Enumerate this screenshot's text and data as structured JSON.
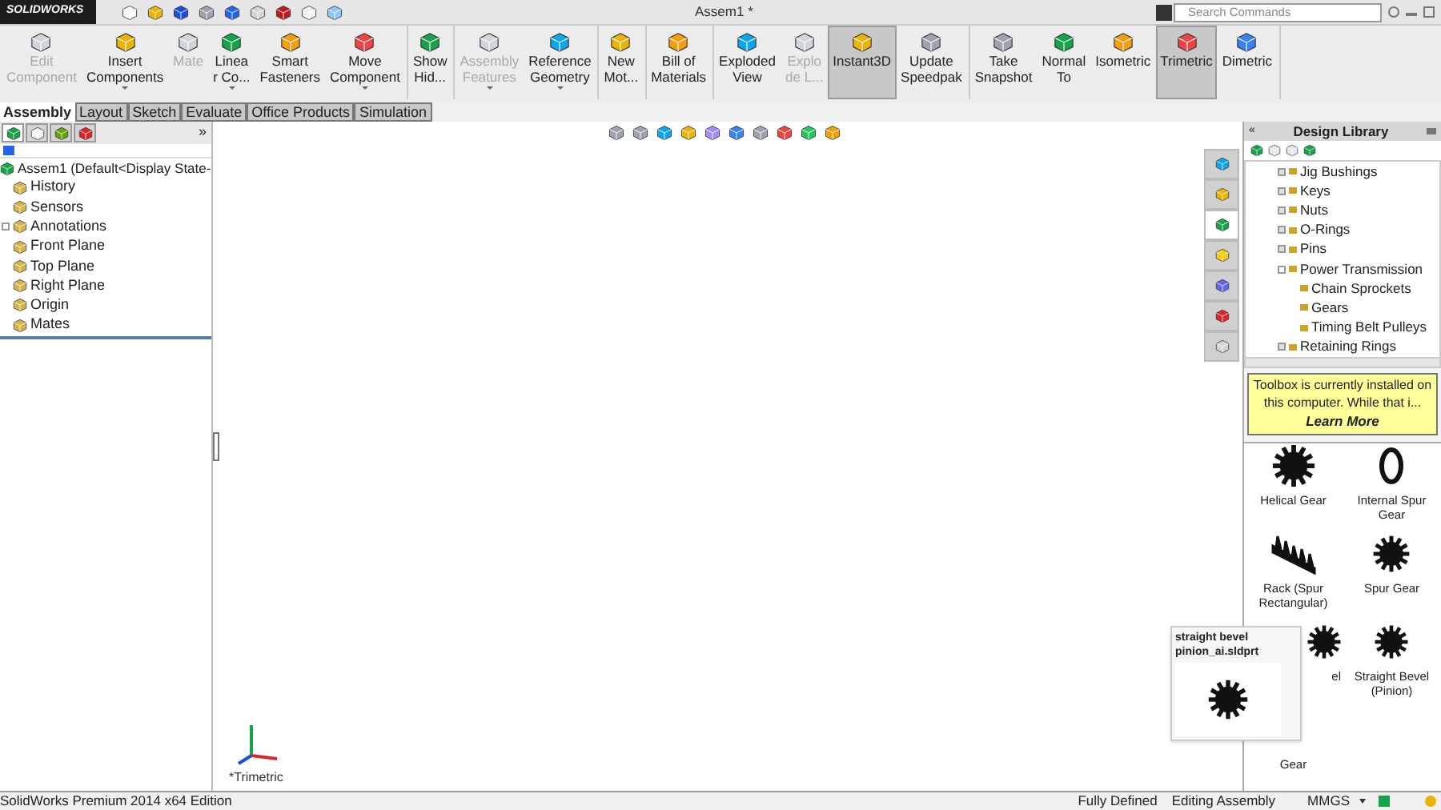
{
  "title_bar": {
    "logo": "SOLIDWORKS",
    "title": "Assem1 *",
    "search": {
      "placeholder": "Search Commands"
    }
  },
  "ribbon": {
    "groups": [
      {
        "buttons": [
          {
            "lines": [
              "Edit",
              "Component"
            ],
            "disabled": true,
            "selected": false,
            "menu": false
          },
          {
            "lines": [
              "Insert",
              "Components"
            ],
            "disabled": false,
            "selected": false,
            "menu": true
          },
          {
            "lines": [
              "Mate"
            ],
            "disabled": true,
            "selected": false,
            "menu": false
          },
          {
            "lines": [
              "Linea",
              "r Co..."
            ],
            "disabled": false,
            "selected": false,
            "menu": true
          },
          {
            "lines": [
              "Smart",
              "Fasteners"
            ],
            "disabled": false,
            "selected": false,
            "menu": false
          },
          {
            "lines": [
              "Move",
              "Component"
            ],
            "disabled": false,
            "selected": false,
            "menu": true
          }
        ]
      },
      {
        "buttons": [
          {
            "lines": [
              "Show",
              "Hid..."
            ],
            "disabled": false,
            "selected": false,
            "menu": false
          }
        ]
      },
      {
        "buttons": [
          {
            "lines": [
              "Assembly",
              "Features"
            ],
            "disabled": true,
            "selected": false,
            "menu": true
          },
          {
            "lines": [
              "Reference",
              "Geometry"
            ],
            "disabled": false,
            "selected": false,
            "menu": true
          }
        ]
      },
      {
        "buttons": [
          {
            "lines": [
              "New",
              "Mot..."
            ],
            "disabled": false,
            "selected": false,
            "menu": false
          }
        ]
      },
      {
        "buttons": [
          {
            "lines": [
              "Bill of",
              "Materials"
            ],
            "disabled": false,
            "selected": false,
            "menu": false
          }
        ]
      },
      {
        "buttons": [
          {
            "lines": [
              "Exploded",
              "View"
            ],
            "disabled": false,
            "selected": false,
            "menu": false
          },
          {
            "lines": [
              "Explo",
              "de L..."
            ],
            "disabled": true,
            "selected": false,
            "menu": false
          },
          {
            "lines": [
              "Instant3D"
            ],
            "disabled": false,
            "selected": true,
            "menu": false
          },
          {
            "lines": [
              "Update",
              "Speedpak"
            ],
            "disabled": false,
            "selected": false,
            "menu": false
          }
        ]
      },
      {
        "buttons": [
          {
            "lines": [
              "Take",
              "Snapshot"
            ],
            "disabled": false,
            "selected": false,
            "menu": false
          },
          {
            "lines": [
              "Normal",
              "To"
            ],
            "disabled": false,
            "selected": false,
            "menu": false
          },
          {
            "lines": [
              "Isometric"
            ],
            "disabled": false,
            "selected": false,
            "menu": false
          },
          {
            "lines": [
              "Trimetric"
            ],
            "disabled": false,
            "selected": true,
            "menu": false
          },
          {
            "lines": [
              "Dimetric"
            ],
            "disabled": false,
            "selected": false,
            "menu": false
          }
        ]
      }
    ]
  },
  "tabs": [
    {
      "label": "Assembly",
      "selected": true
    },
    {
      "label": "Layout",
      "selected": false
    },
    {
      "label": "Sketch",
      "selected": false
    },
    {
      "label": "Evaluate",
      "selected": false
    },
    {
      "label": "Office Products",
      "selected": false
    },
    {
      "label": "Simulation",
      "selected": false
    }
  ],
  "feature_tree": {
    "panel_tabs": [
      {
        "selected": true
      },
      {
        "selected": false
      },
      {
        "selected": false
      },
      {
        "selected": false
      }
    ],
    "collapse": "»",
    "root": "Assem1  (Default<Display State-",
    "items": [
      {
        "label": "History",
        "expandable": false
      },
      {
        "label": "Sensors",
        "expandable": false
      },
      {
        "label": "Annotations",
        "expandable": true
      },
      {
        "label": "Front Plane",
        "expandable": false
      },
      {
        "label": "Top Plane",
        "expandable": false
      },
      {
        "label": "Right Plane",
        "expandable": false
      },
      {
        "label": "Origin",
        "expandable": false
      },
      {
        "label": "Mates",
        "expandable": false
      }
    ]
  },
  "viewport": {
    "view_name": "*Trimetric"
  },
  "task_tabs": [
    {
      "selected": false
    },
    {
      "selected": false
    },
    {
      "selected": true
    },
    {
      "selected": false
    },
    {
      "selected": false
    },
    {
      "selected": false
    },
    {
      "selected": false
    }
  ],
  "design_library": {
    "title": "Design Library",
    "collapse": "«",
    "tree": [
      {
        "label": "Jig Bushings",
        "expanded": false
      },
      {
        "label": "Keys",
        "expanded": false
      },
      {
        "label": "Nuts",
        "expanded": false
      },
      {
        "label": "O-Rings",
        "expanded": false
      },
      {
        "label": "Pins",
        "expanded": false
      },
      {
        "label": "Power Transmission",
        "expanded": true,
        "children": [
          {
            "label": "Chain Sprockets"
          },
          {
            "label": "Gears"
          },
          {
            "label": "Timing Belt Pulleys"
          }
        ]
      },
      {
        "label": "Retaining Rings",
        "expanded": false
      }
    ],
    "note": {
      "text": "Toolbox is currently installed on this computer. While that i...",
      "link": "Learn More"
    },
    "parts": [
      {
        "kind": "helical",
        "lines": [
          "Helical Gear"
        ],
        "covered": false
      },
      {
        "kind": "ring",
        "lines": [
          "Internal Spur",
          "Gear"
        ],
        "covered": false
      },
      {
        "kind": "rack",
        "lines": [
          "Rack (Spur",
          "Rectangular)"
        ],
        "covered": false
      },
      {
        "kind": "spur",
        "lines": [
          "Spur Gear"
        ],
        "covered": false
      },
      {
        "kind": "bevel",
        "lines": [
          "el"
        ],
        "covered": true
      },
      {
        "kind": "bevel",
        "lines": [
          "Straight Bevel",
          "(Pinion)"
        ],
        "covered": false
      },
      {
        "kind": "none",
        "lines": [
          "Gear"
        ],
        "covered": false
      }
    ],
    "tooltip": {
      "title": "straight bevel pinion_ai.sldprt"
    }
  },
  "status_bar": {
    "edition": "SolidWorks Premium 2014 x64 Edition",
    "state": "Fully Defined",
    "mode": "Editing Assembly",
    "units": "MMGS"
  }
}
